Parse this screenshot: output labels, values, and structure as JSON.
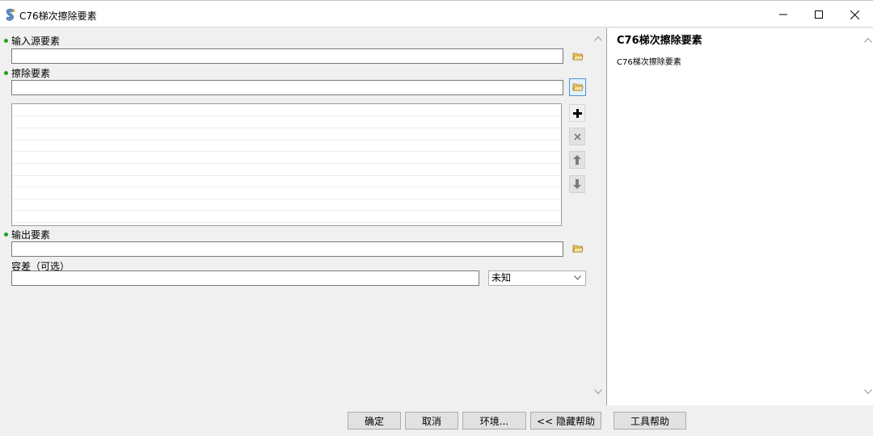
{
  "window": {
    "title": "C76梯次擦除要素",
    "icon": "script-tool-icon",
    "controls": [
      "minimize-icon",
      "maximize-icon",
      "close-icon"
    ]
  },
  "form": {
    "input_features": {
      "label": "输入源要素",
      "value": "",
      "required": true
    },
    "erase_features": {
      "label": "擦除要素",
      "value": "",
      "required": true,
      "list_items": []
    },
    "output_features": {
      "label": "输出要素",
      "value": "",
      "required": true
    },
    "tolerance": {
      "label": "容差（可选）",
      "value": "",
      "unit_selected": "未知"
    }
  },
  "list_controls": [
    "add-icon",
    "remove-icon",
    "move-up-icon",
    "move-down-icon"
  ],
  "help": {
    "title": "C76梯次擦除要素",
    "body": "C76梯次擦除要素"
  },
  "buttons": {
    "ok": "确定",
    "cancel": "取消",
    "environments": "环境...",
    "hide_help": "<< 隐藏帮助",
    "tool_help": "工具帮助"
  },
  "colors": {
    "required_bullet": "#1fa11f",
    "active_border": "#4a90d9"
  }
}
